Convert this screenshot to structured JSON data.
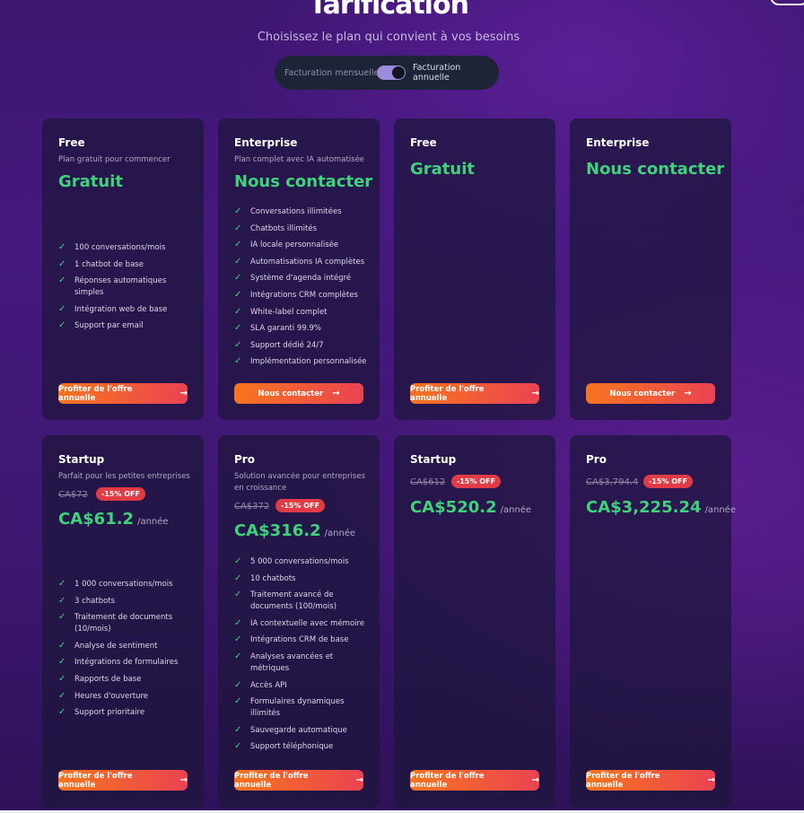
{
  "header": {
    "title": "Tarification",
    "subtitle": "Choisissez le plan qui convient à vos besoins"
  },
  "billing_toggle": {
    "monthly_label": "Facturation mensuelle",
    "annual_label": "Facturation annuelle",
    "selected": "annual"
  },
  "check_icon": "✓",
  "arrow_icon": "→",
  "colors": {
    "accent_green": "#3fd27a",
    "discount_red": "#e13b45",
    "button_orange": "#f7741f"
  },
  "cards": [
    {
      "name": "Free",
      "description": "Plan gratuit pour commencer",
      "headline": "Gratuit",
      "features": [
        "100 conversations/mois",
        "1 chatbot de base",
        "Réponses automatiques simples",
        "Intégration web de base",
        "Support par email"
      ],
      "button": "Profiter de l'offre annuelle"
    },
    {
      "name": "Enterprise",
      "description": "Plan complet avec IA automatisée",
      "headline": "Nous contacter",
      "features": [
        "Conversations illimitées",
        "Chatbots illimités",
        "IA locale personnalisée",
        "Automatisations IA complètes",
        "Système d'agenda intégré",
        "Intégrations CRM complètes",
        "White-label complet",
        "SLA garanti 99.9%",
        "Support dédié 24/7",
        "Implémentation personnalisée"
      ],
      "button": "Nous contacter"
    },
    {
      "name": "Free",
      "headline": "Gratuit",
      "button": "Profiter de l'offre annuelle"
    },
    {
      "name": "Enterprise",
      "headline": "Nous contacter",
      "button": "Nous contacter"
    },
    {
      "name": "Startup",
      "description": "Parfait pour les petites entreprises",
      "old_price": "CA$72",
      "discount": "-15% OFF",
      "price": "CA$61.2",
      "period": "/année",
      "features": [
        "1 000 conversations/mois",
        "3 chatbots",
        "Traitement de documents (10/mois)",
        "Analyse de sentiment",
        "Intégrations de formulaires",
        "Rapports de base",
        "Heures d'ouverture",
        "Support prioritaire"
      ],
      "button": "Profiter de l'offre annuelle"
    },
    {
      "name": "Pro",
      "description": "Solution avancée pour entreprises en croissance",
      "old_price": "CA$372",
      "discount": "-15% OFF",
      "price": "CA$316.2",
      "period": "/année",
      "features": [
        "5 000 conversations/mois",
        "10 chatbots",
        "Traitement avancé de documents (100/mois)",
        "IA contextuelle avec mémoire",
        "Intégrations CRM de base",
        "Analyses avancées et métriques",
        "Accès API",
        "Formulaires dynamiques illimités",
        "Sauvegarde automatique",
        "Support téléphonique"
      ],
      "button": "Profiter de l'offre annuelle"
    },
    {
      "name": "Startup",
      "old_price": "CA$612",
      "discount": "-15% OFF",
      "price": "CA$520.2",
      "period": "/année",
      "button": "Profiter de l'offre annuelle"
    },
    {
      "name": "Pro",
      "old_price": "CA$3,794.4",
      "discount": "-15% OFF",
      "price": "CA$3,225.24",
      "period": "/année",
      "button": "Profiter de l'offre annuelle"
    }
  ]
}
